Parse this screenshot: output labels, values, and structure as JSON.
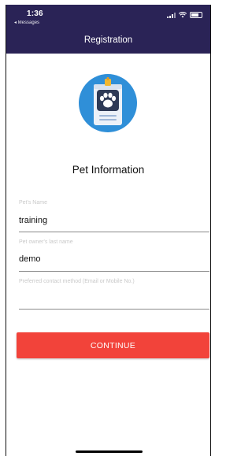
{
  "status_bar": {
    "time": "1:36",
    "back_app": "◂ Messages"
  },
  "nav": {
    "title": "Registration"
  },
  "logo": {
    "icon": "pet-id-badge-icon",
    "circle_color": "#2f8fd8"
  },
  "form": {
    "section_title": "Pet Information",
    "pet_name": {
      "label": "Pet's Name",
      "value": "training"
    },
    "owner_last_name": {
      "label": "Pet owner's last name",
      "value": "demo"
    },
    "contact_method": {
      "label": "Preferred contact method (Email or Mobile No.)",
      "value": ""
    }
  },
  "actions": {
    "continue_label": "CONTINUE",
    "continue_color": "#f2433a"
  },
  "colors": {
    "header_bg": "#2a2356"
  }
}
